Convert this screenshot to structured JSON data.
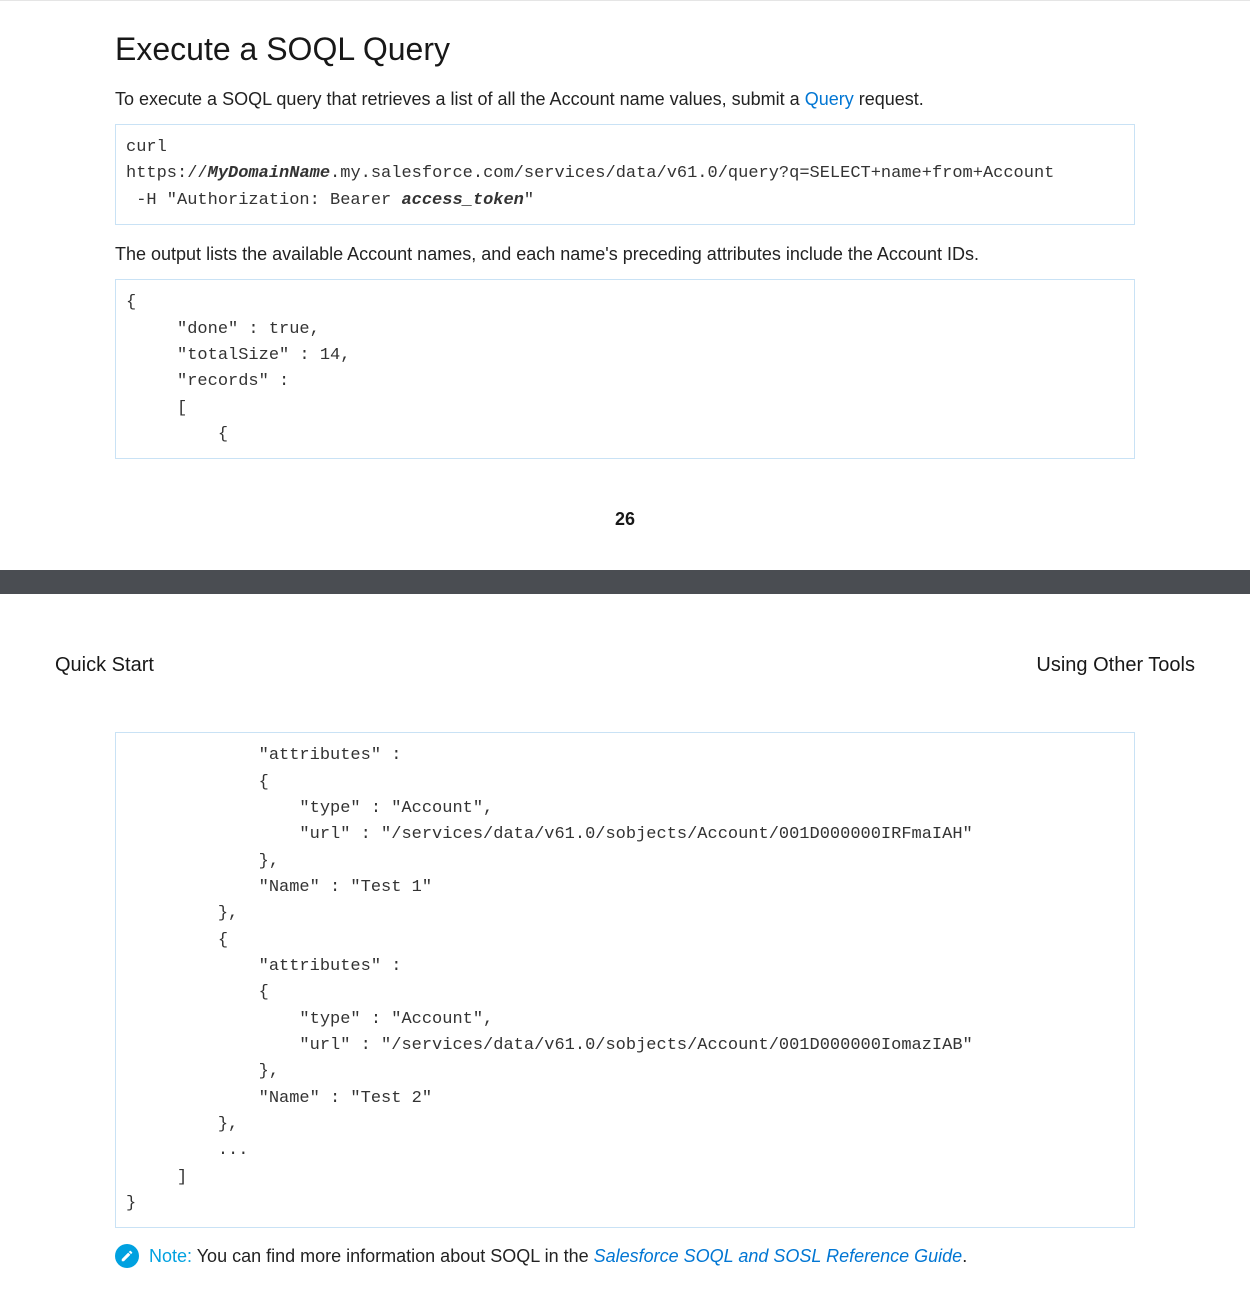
{
  "page1": {
    "title": "Execute a SOQL Query",
    "intro_prefix": "To execute a SOQL query that retrieves a list of all the Account name values, submit a ",
    "intro_link": "Query",
    "intro_suffix": " request.",
    "code1_line1_a": "curl",
    "code1_line2_a": "https://",
    "code1_line2_bold": "MyDomainName",
    "code1_line2_b": ".my.salesforce.com/services/data/v61.0/query?q=SELECT+name+from+Account",
    "code1_line3_a": " -H \"Authorization: Bearer ",
    "code1_line3_bold": "access_token",
    "code1_line3_b": "\"",
    "output_desc": "The output lists the available Account names, and each name's preceding attributes include the Account IDs.",
    "code2": "{\n     \"done\" : true,\n     \"totalSize\" : 14,\n     \"records\" :\n     [\n         {",
    "page_number": "26"
  },
  "page2": {
    "header_left": "Quick Start",
    "header_right": "Using Other Tools",
    "code3": "             \"attributes\" :\n             {\n                 \"type\" : \"Account\",\n                 \"url\" : \"/services/data/v61.0/sobjects/Account/001D000000IRFmaIAH\"\n             },\n             \"Name\" : \"Test 1\"\n         },\n         {\n             \"attributes\" :\n             {\n                 \"type\" : \"Account\",\n                 \"url\" : \"/services/data/v61.0/sobjects/Account/001D000000IomazIAB\"\n             },\n             \"Name\" : \"Test 2\"\n         },\n         ...\n     ]\n}",
    "note_label": "Note:",
    "note_text_a": "  You can find more information about SOQL in the ",
    "note_link": "Salesforce SOQL and SOSL Reference Guide",
    "note_text_b": "."
  }
}
